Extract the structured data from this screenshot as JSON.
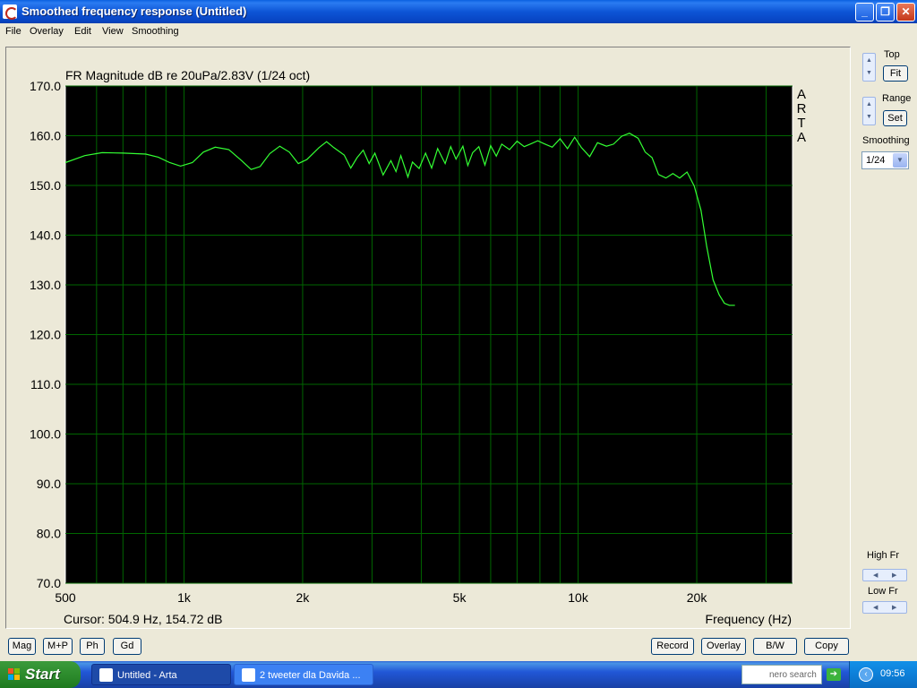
{
  "window": {
    "title": "Smoothed frequency response (Untitled)",
    "controls": {
      "minimize": "_",
      "maximize": "❐",
      "close": "✕"
    }
  },
  "menu": [
    "File",
    "Overlay",
    "Edit",
    "View",
    "Smoothing"
  ],
  "chart_data": {
    "type": "line",
    "title": "FR Magnitude dB re 20uPa/2.83V (1/24 oct)",
    "watermark": [
      "A",
      "R",
      "T",
      "A"
    ],
    "xlabel": "Frequency (Hz)",
    "x_scale": "log",
    "xlim": [
      500,
      35000
    ],
    "ylim": [
      70,
      170
    ],
    "x_ticks": [
      {
        "value": 500,
        "label": "500"
      },
      {
        "value": 1000,
        "label": "1k"
      },
      {
        "value": 2000,
        "label": "2k"
      },
      {
        "value": 5000,
        "label": "5k"
      },
      {
        "value": 10000,
        "label": "10k"
      },
      {
        "value": 20000,
        "label": "20k"
      }
    ],
    "x_minor_grid": [
      600,
      700,
      800,
      900,
      3000,
      4000,
      6000,
      7000,
      8000,
      9000,
      30000
    ],
    "y_ticks": [
      "70.0",
      "80.0",
      "90.0",
      "100.0",
      "110.0",
      "120.0",
      "130.0",
      "140.0",
      "150.0",
      "160.0",
      "170.0"
    ],
    "y_tick_values": [
      70,
      80,
      90,
      100,
      110,
      120,
      130,
      140,
      150,
      160,
      170
    ],
    "grid": true,
    "colors": {
      "background": "#000000",
      "grid": "#006600",
      "line": "#33ff33",
      "frame": "#ffffff"
    },
    "series": [
      {
        "x": [
          500,
          560,
          620,
          700,
          800,
          860,
          920,
          980,
          1050,
          1120,
          1200,
          1300,
          1400,
          1480,
          1560,
          1650,
          1750,
          1850,
          1950,
          2050,
          2200,
          2300,
          2400,
          2550,
          2650,
          2750,
          2850,
          2950,
          3050,
          3200,
          3350,
          3450,
          3550,
          3700,
          3800,
          3950,
          4100,
          4250,
          4400,
          4600,
          4750,
          4900,
          5100,
          5250,
          5400,
          5600,
          5800,
          6000,
          6200,
          6400,
          6700,
          7000,
          7300,
          7600,
          7900,
          8200,
          8600,
          9000,
          9400,
          9800,
          10200,
          10700,
          11200,
          11800,
          12300,
          12900,
          13500,
          14200,
          14800,
          15400,
          16000,
          16700,
          17400,
          18100,
          18900,
          19700,
          20500,
          21200,
          22000,
          22800,
          23500,
          24200,
          25000
        ],
        "y": [
          154.6,
          156.0,
          156.6,
          156.5,
          156.3,
          155.7,
          154.6,
          153.9,
          154.6,
          156.7,
          157.7,
          157.2,
          155.0,
          153.2,
          153.8,
          156.4,
          157.9,
          156.7,
          154.4,
          155.2,
          157.6,
          158.8,
          157.6,
          156.1,
          153.5,
          155.6,
          157.1,
          154.4,
          156.5,
          152.1,
          155.0,
          152.8,
          156.0,
          151.7,
          154.7,
          153.4,
          156.5,
          153.5,
          157.4,
          154.4,
          157.8,
          155.3,
          157.9,
          154.0,
          156.6,
          157.8,
          154.1,
          158.0,
          155.9,
          158.3,
          157.2,
          158.9,
          157.8,
          158.4,
          159.0,
          158.4,
          157.7,
          159.4,
          157.4,
          159.7,
          157.6,
          155.8,
          158.6,
          157.9,
          158.3,
          159.9,
          160.5,
          159.5,
          156.7,
          155.6,
          152.2,
          151.5,
          152.4,
          151.5,
          152.7,
          149.9,
          145.0,
          137.7,
          131.0,
          128.0,
          126.3,
          125.9,
          125.9
        ]
      }
    ]
  },
  "cursor_readout": "Cursor: 504.9 Hz, 154.72 dB",
  "right_panel": {
    "top_label": "Top",
    "fit_button": "Fit",
    "range_label": "Range",
    "set_button": "Set",
    "smoothing_label": "Smoothing",
    "smoothing_value": "1/24",
    "high_fr_label": "High Fr",
    "low_fr_label": "Low Fr"
  },
  "bottom_left_buttons": [
    "Mag",
    "M+P",
    "Ph",
    "Gd"
  ],
  "bottom_right_buttons": [
    "Record",
    "Overlay",
    "B/W",
    "Copy"
  ],
  "taskbar": {
    "start_label": "Start",
    "tasks": [
      {
        "label": "Untitled - Arta",
        "active": true
      },
      {
        "label": "2 tweeter dla Davida ...",
        "active": false
      }
    ],
    "nero_label": "nero search",
    "clock": "09:56"
  }
}
